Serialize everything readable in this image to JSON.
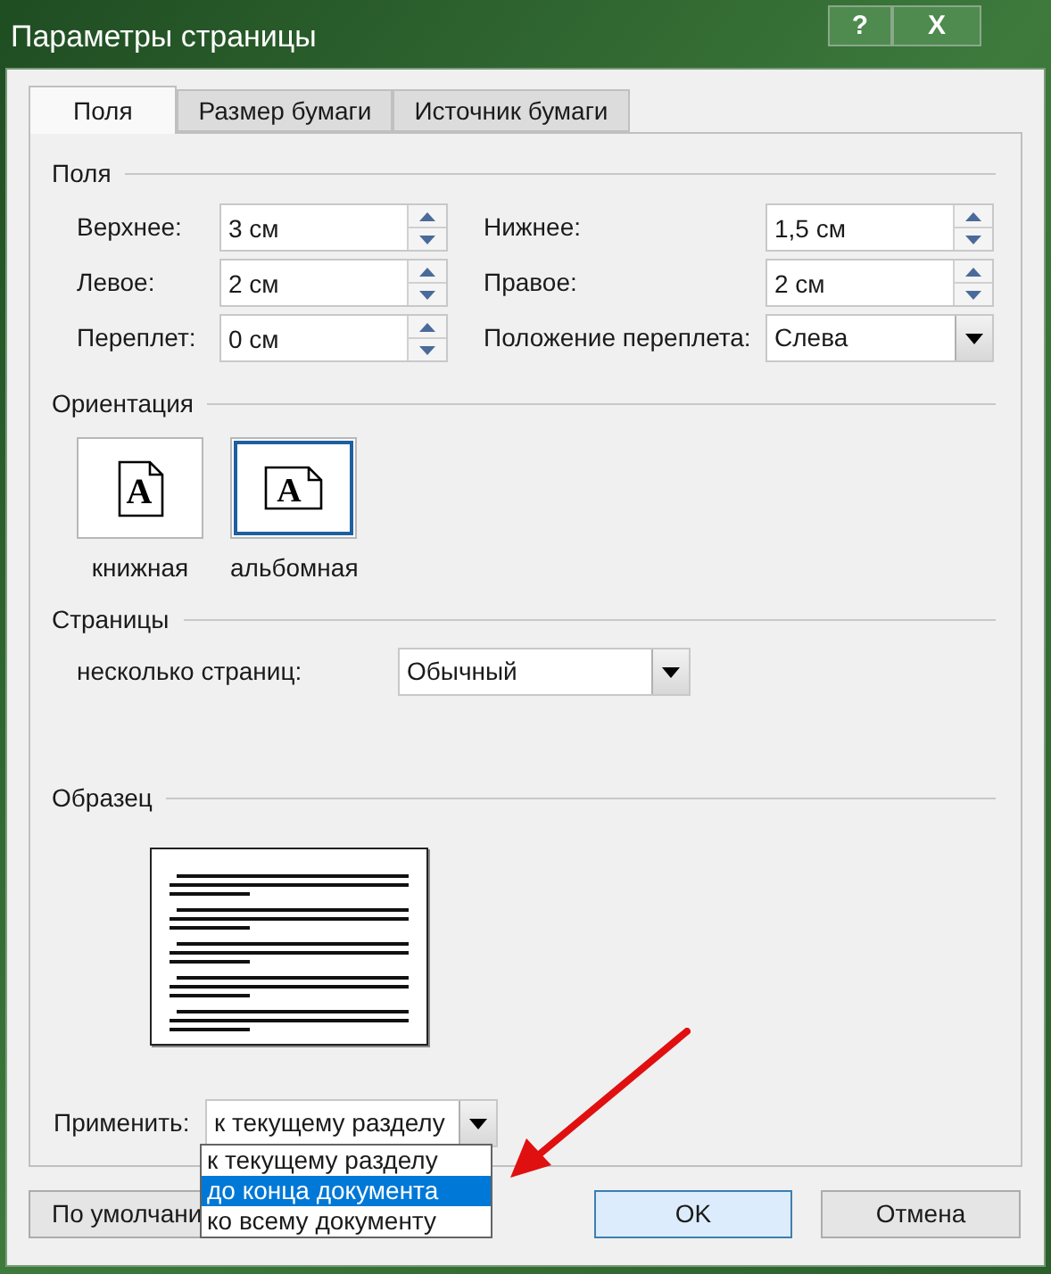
{
  "window": {
    "title": "Параметры страницы",
    "help": "?",
    "close": "X"
  },
  "tabs": [
    {
      "label": "Поля",
      "selected": true
    },
    {
      "label": "Размер бумаги",
      "selected": false
    },
    {
      "label": "Источник бумаги",
      "selected": false
    }
  ],
  "margins": {
    "title": "Поля",
    "fields": [
      {
        "label": "Верхнее:",
        "value": "3 см",
        "kind": "spin"
      },
      {
        "label": "Нижнее:",
        "value": "1,5 см",
        "kind": "spin"
      },
      {
        "label": "Левое:",
        "value": "2 см",
        "kind": "spin"
      },
      {
        "label": "Правое:",
        "value": "2 см",
        "kind": "spin"
      },
      {
        "label": "Переплет:",
        "value": "0 см",
        "kind": "spin"
      },
      {
        "label": "Положение переплета:",
        "value": "Слева",
        "kind": "combo"
      }
    ]
  },
  "orientation": {
    "title": "Ориентация",
    "options": [
      {
        "label": "книжная",
        "kind": "portrait",
        "glyph": "A",
        "selected": false
      },
      {
        "label": "альбомная",
        "kind": "landscape",
        "glyph": "A",
        "selected": true
      }
    ]
  },
  "pages": {
    "title": "Страницы",
    "label": "несколько страниц:",
    "value": "Обычный"
  },
  "sample": {
    "title": "Образец"
  },
  "apply": {
    "label": "Применить:",
    "value": "к текущему разделу",
    "options": [
      {
        "label": "к текущему разделу",
        "highlighted": false
      },
      {
        "label": "до конца документа",
        "highlighted": true
      },
      {
        "label": "ко всему документу",
        "highlighted": false
      }
    ]
  },
  "buttons": {
    "default": "По умолчани",
    "ok": "OK",
    "cancel": "Отмена"
  }
}
